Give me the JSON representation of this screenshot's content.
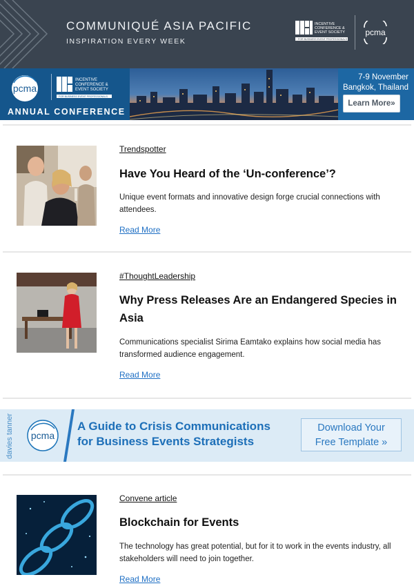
{
  "header": {
    "title": "COMMUNIQUÉ ASIA PACIFIC",
    "subtitle": "INSPIRATION EVERY WEEK",
    "ices_logo_lines": [
      "INCENTIVE",
      "CONFERENCE &",
      "EVENT SOCIETY",
      "FOR BUSINESS EVENT PROFESSIONALS"
    ],
    "pcma_logo": "pcma"
  },
  "conference_banner": {
    "title": "ANNUAL CONFERENCE",
    "date": "7-9 November",
    "location": "Bangkok, Thailand",
    "button_label": "Learn More»",
    "pcma_logo": "pcma",
    "ices_logo_lines": [
      "INCENTIVE",
      "CONFERENCE &",
      "EVENT SOCIETY",
      "FOR BUSINESS EVENT PROFESSIONALS"
    ]
  },
  "articles": [
    {
      "category": "Trendspotter",
      "headline": "Have You Heard of the ‘Un-conference’?",
      "description": "Unique event formats and innovative design forge crucial connections with attendees.",
      "link": "Read More",
      "image_icon": "women-at-event-photo"
    },
    {
      "category": "#ThoughtLeadership",
      "headline": "Why Press Releases Are an Endangered Species in Asia",
      "description": "Communications specialist Sirima Eamtako explains how social media has transformed audience engagement.",
      "link": "Read More",
      "image_icon": "woman-in-red-dress-photo"
    },
    {
      "category": "Convene article",
      "headline": "Blockchain for Events",
      "description": "The technology has great potential, but for it to work in the events industry, all stakeholders will need to join together.",
      "link": "Read More",
      "image_icon": "blockchain-chain-photo"
    }
  ],
  "crisis_banner": {
    "line1": "A Guide to Crisis Communications",
    "line2": "for Business Events Strategists",
    "button_line1": "Download Your",
    "button_line2": "Free Template »",
    "davies_label": "davies tanner",
    "pcma_logo": "pcma"
  },
  "colors": {
    "header_bg": "#3a4450",
    "conference_blue": "#14598f",
    "link_blue": "#1e6fc4",
    "crisis_bg": "#dcebf6",
    "crisis_text": "#1d6fb8"
  }
}
